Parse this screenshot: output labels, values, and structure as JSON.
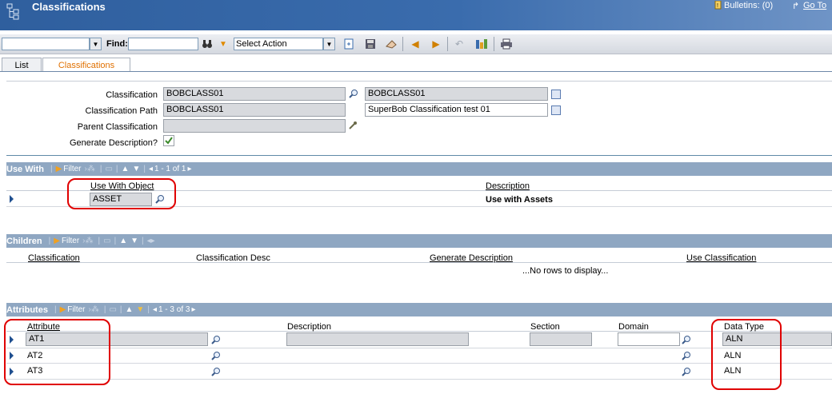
{
  "header": {
    "title": "Classifications",
    "bulletins": "Bulletins: (0)",
    "goto": "Go To"
  },
  "toolbar": {
    "find_label": "Find:",
    "find_value": "",
    "query_value": "",
    "select_action": "Select Action"
  },
  "tabs": [
    {
      "label": "List"
    },
    {
      "label": "Classifications"
    }
  ],
  "form": {
    "classification_label": "Classification",
    "classification_value": "BOBCLASS01",
    "classification_desc": "BOBCLASS01",
    "path_label": "Classification Path",
    "path_value": "BOBCLASS01",
    "path_desc": "SuperBob Classification test 01",
    "parent_label": "Parent Classification",
    "parent_value": "",
    "gen_desc_label": "Generate Description?",
    "gen_desc_checked": true
  },
  "use_with": {
    "title": "Use With",
    "filter": "Filter",
    "paging": "1 - 1 of 1",
    "col_object": "Use With Object",
    "col_desc": "Description",
    "rows": [
      {
        "object": "ASSET",
        "description": "Use with Assets"
      }
    ]
  },
  "children": {
    "title": "Children",
    "filter": "Filter",
    "col_classification": "Classification",
    "col_desc": "Classification Desc",
    "col_gen": "Generate Description",
    "col_use": "Use Classification",
    "empty": "...No rows to display..."
  },
  "attributes": {
    "title": "Attributes",
    "filter": "Filter",
    "paging": "1 - 3 of 3",
    "col_attribute": "Attribute",
    "col_desc": "Description",
    "col_section": "Section",
    "col_domain": "Domain",
    "col_type": "Data Type",
    "rows": [
      {
        "attribute": "AT1",
        "type": "ALN"
      },
      {
        "attribute": "AT2",
        "type": "ALN"
      },
      {
        "attribute": "AT3",
        "type": "ALN"
      }
    ]
  },
  "colors": {
    "header": "#3a6cad",
    "section_bar": "#8fa7c2",
    "active_tab": "#e07000",
    "highlight": "#e00000"
  }
}
